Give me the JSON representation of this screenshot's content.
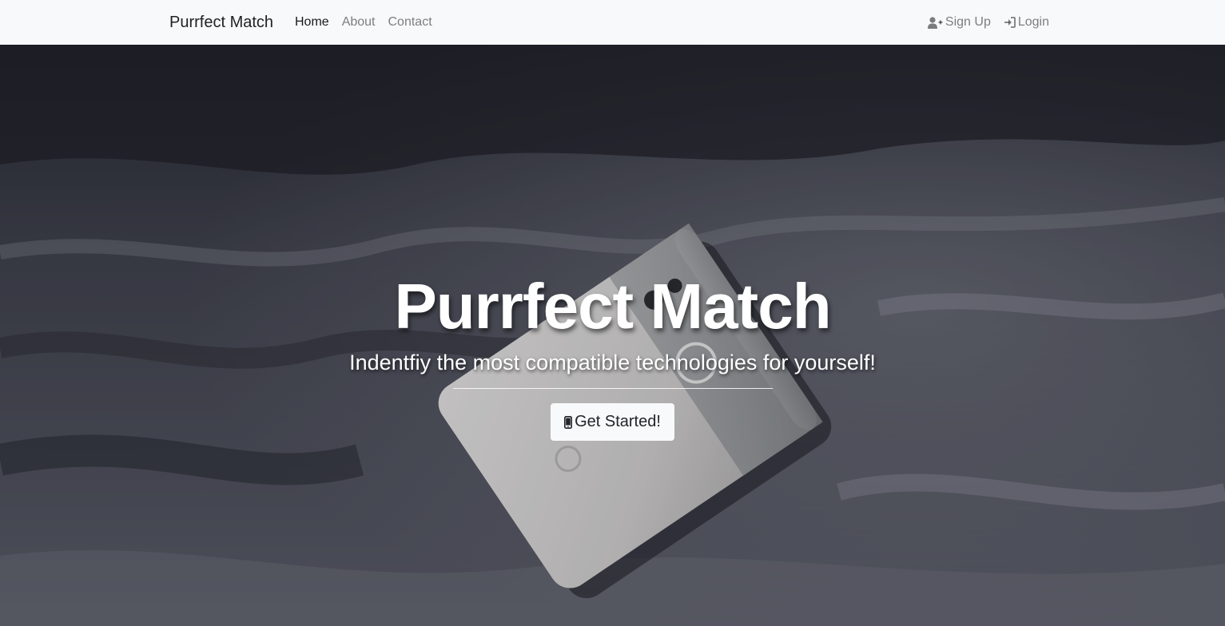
{
  "navbar": {
    "brand": "Purrfect Match",
    "links": [
      {
        "label": "Home",
        "active": true
      },
      {
        "label": "About",
        "active": false
      },
      {
        "label": "Contact",
        "active": false
      }
    ],
    "right": [
      {
        "label": "Sign Up",
        "icon": "user-plus-icon"
      },
      {
        "label": "Login",
        "icon": "sign-in-icon"
      }
    ]
  },
  "hero": {
    "title": "Purrfect Match",
    "subtitle": "Indentfiy the most compatible technologies for yourself!",
    "cta": {
      "label": "Get Started!",
      "icon": "mobile-phone-icon"
    },
    "background": "bed-sheets-with-phone-photo"
  },
  "colors": {
    "navbar_bg": "#f8f9fa",
    "button_bg": "#f8f9fa",
    "hero_text": "#ffffff"
  }
}
